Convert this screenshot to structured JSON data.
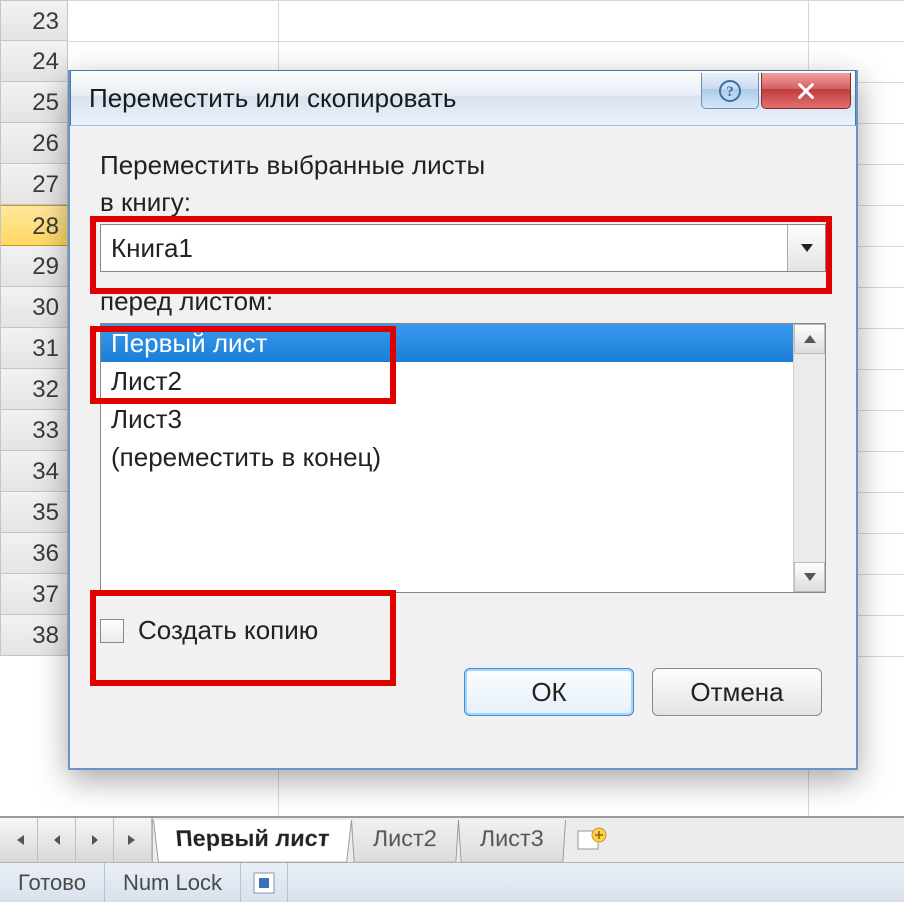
{
  "rows": [
    "23",
    "24",
    "25",
    "26",
    "27",
    "28",
    "29",
    "30",
    "31",
    "32",
    "33",
    "34",
    "35",
    "36",
    "37",
    "38"
  ],
  "selected_row_index": 5,
  "dialog": {
    "title": "Переместить или скопировать",
    "label_move_selected": "Переместить выбранные листы",
    "label_to_book": "в книгу:",
    "book_value": "Книга1",
    "label_before_sheet": "перед листом:",
    "sheets": [
      "Первый лист",
      "Лист2",
      "Лист3",
      "(переместить в конец)"
    ],
    "selected_sheet_index": 0,
    "checkbox_label": "Создать копию",
    "ok_label": "ОК",
    "cancel_label": "Отмена"
  },
  "tabs": {
    "items": [
      "Первый лист",
      "Лист2",
      "Лист3"
    ],
    "active_index": 0
  },
  "status": {
    "ready": "Готово",
    "numlock": "Num Lock"
  }
}
